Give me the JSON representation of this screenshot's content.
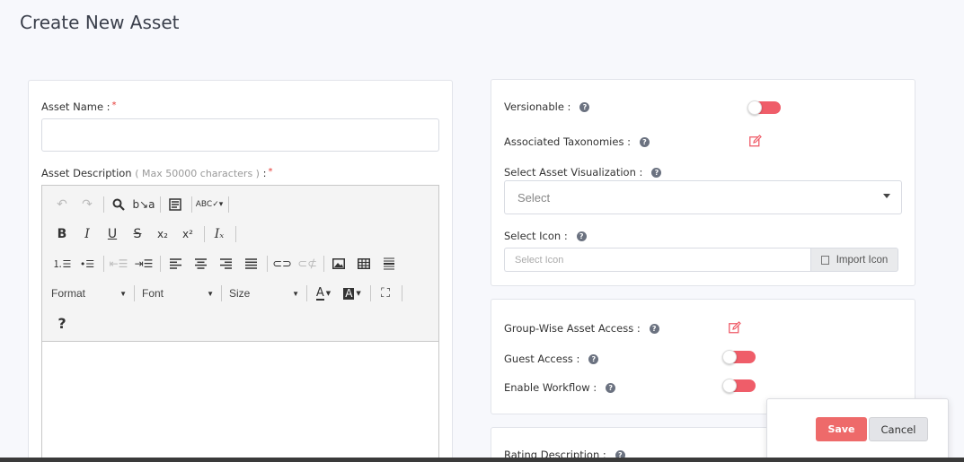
{
  "page": {
    "title": "Create New Asset"
  },
  "left_form": {
    "asset_name_label": "Asset Name :",
    "required_mark": "*",
    "asset_name_value": "",
    "asset_description_label": "Asset Description",
    "asset_description_hint": "( Max 50000 characters )",
    "asset_description_colon": " :",
    "editor": {
      "format_label": "Format",
      "font_label": "Font",
      "size_label": "Size",
      "help_label": "?"
    }
  },
  "right_form": {
    "versionable_label": "Versionable :",
    "associated_taxonomies_label": "Associated Taxonomies :",
    "select_visualization_label": "Select Asset Visualization :",
    "select_visualization_value": "Select",
    "select_icon_label": "Select Icon :",
    "select_icon_placeholder": "Select Icon",
    "import_icon_label": "Import Icon",
    "group_wise_access_label": "Group-Wise Asset Access :",
    "guest_access_label": "Guest Access :",
    "enable_workflow_label": "Enable Workflow :",
    "rating_description_label": "Rating Description :"
  },
  "actions": {
    "save_label": "Save",
    "cancel_label": "Cancel"
  },
  "colors": {
    "accent": "#ee6a6a",
    "toggle": "#ef5d69"
  }
}
